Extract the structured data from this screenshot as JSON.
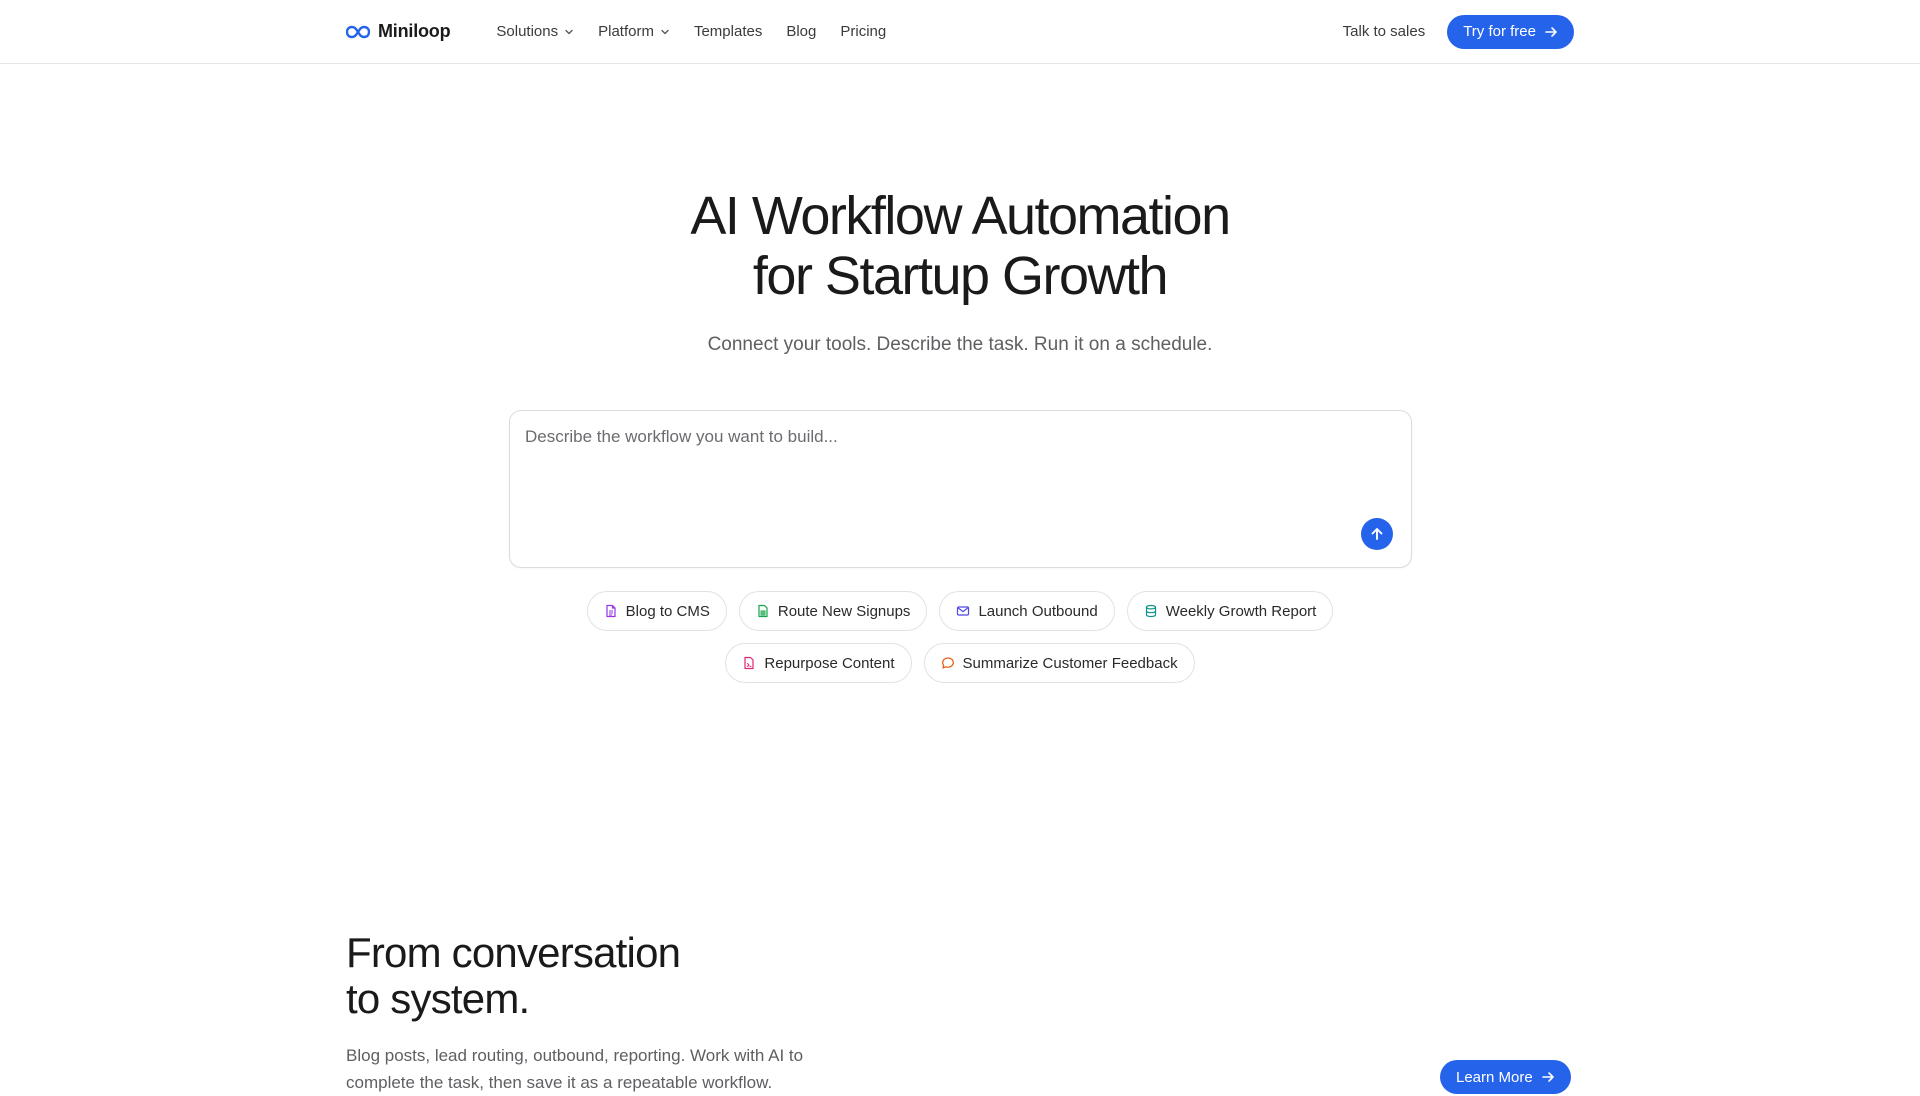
{
  "nav": {
    "brand": "Miniloop",
    "links": [
      {
        "label": "Solutions",
        "dropdown": true
      },
      {
        "label": "Platform",
        "dropdown": true
      },
      {
        "label": "Templates",
        "dropdown": false
      },
      {
        "label": "Blog",
        "dropdown": false
      },
      {
        "label": "Pricing",
        "dropdown": false
      }
    ],
    "talk_to_sales": "Talk to sales",
    "cta": "Try for free"
  },
  "hero": {
    "title_line1": "AI Workflow Automation",
    "title_line2": "for Startup Growth",
    "subtitle": "Connect your tools. Describe the task. Run it on a schedule.",
    "prompt_placeholder": "Describe the workflow you want to build...",
    "prompt_value": ""
  },
  "chips": [
    {
      "label": "Blog to CMS",
      "icon": "document-icon",
      "color": "#9333ea"
    },
    {
      "label": "Route New Signups",
      "icon": "sheet-icon",
      "color": "#16a34a"
    },
    {
      "label": "Launch Outbound",
      "icon": "mail-icon",
      "color": "#4f46e5"
    },
    {
      "label": "Weekly Growth Report",
      "icon": "database-icon",
      "color": "#0d9488"
    },
    {
      "label": "Repurpose Content",
      "icon": "file-icon",
      "color": "#db2777"
    },
    {
      "label": "Summarize Customer Feedback",
      "icon": "chat-bubble-icon",
      "color": "#ea580c"
    }
  ],
  "section": {
    "title_line1": "From conversation",
    "title_line2": "to system.",
    "body": "Blog posts, lead routing, outbound, reporting. Work with AI to complete the task, then save it as a repeatable workflow.",
    "cta": "Learn More"
  },
  "colors": {
    "accent": "#2563eb",
    "text": "#1a1a1a",
    "muted": "#5f5f63",
    "border": "#e2e2e5"
  }
}
